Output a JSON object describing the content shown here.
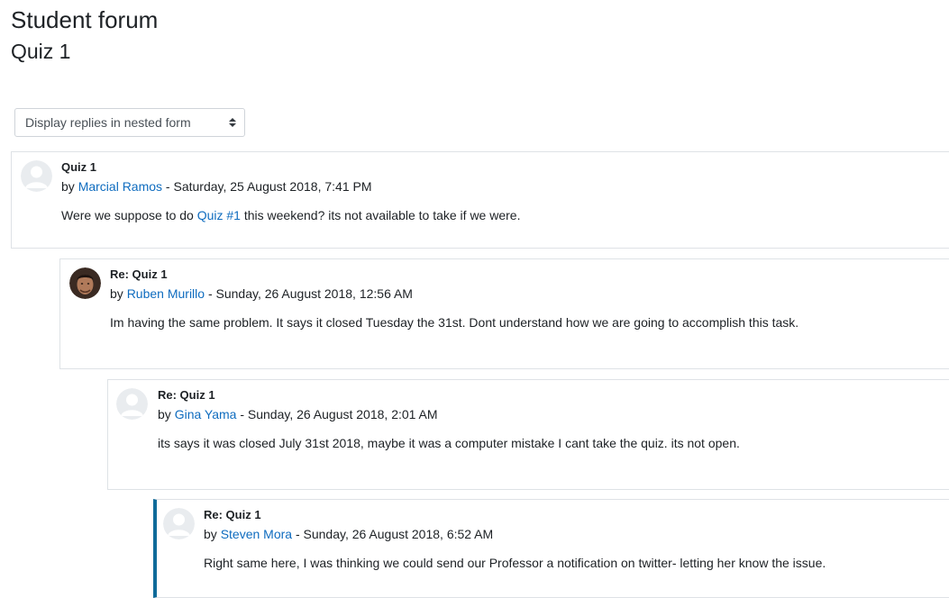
{
  "page": {
    "title": "Student forum",
    "discussion_title": "Quiz 1"
  },
  "display_mode": {
    "selected": "Display replies in nested form"
  },
  "posts": [
    {
      "subject": "Quiz 1",
      "by": "by",
      "author": "Marcial Ramos",
      "date": " - Saturday, 25 August 2018, 7:41 PM",
      "message_before": "Were we suppose to do ",
      "message_link": "Quiz #1",
      "message_after": " this weekend? its not available to take if we were.",
      "avatar": "default-user-icon"
    },
    {
      "subject": "Re: Quiz 1",
      "by": "by",
      "author": "Ruben Murillo",
      "date": " - Sunday, 26 August 2018, 12:56 AM",
      "message": "Im having the same problem. It says it closed Tuesday the 31st. Dont understand how we are going to accomplish this task.",
      "avatar": "user-photo"
    },
    {
      "subject": "Re: Quiz 1",
      "by": "by",
      "author": "Gina Yama",
      "date": " - Sunday, 26 August 2018, 2:01 AM",
      "message": "its says it was closed July 31st 2018, maybe it was a computer mistake I cant take the quiz. its not open.",
      "avatar": "default-user-icon"
    },
    {
      "subject": "Re: Quiz 1",
      "by": "by",
      "author": "Steven Mora",
      "date": " - Sunday, 26 August 2018, 6:52 AM",
      "message": "Right same here, I was thinking we could send our Professor a notification on twitter- letting her know the issue.",
      "avatar": "default-user-icon"
    }
  ],
  "colors": {
    "link": "#0f6cbf",
    "highlight_border": "#0f6b9a",
    "post_border": "#dee2e6"
  }
}
